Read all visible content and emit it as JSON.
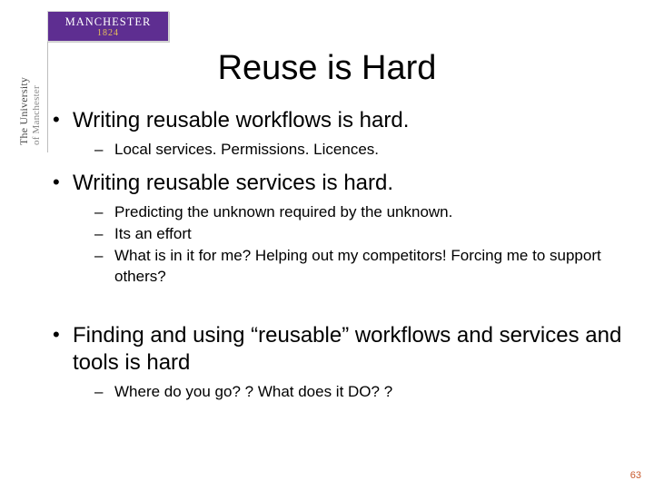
{
  "logo": {
    "line1": "MANCHESTER",
    "line2": "1824"
  },
  "sidebar": {
    "line1": "The University",
    "line2": "of Manchester"
  },
  "title": "Reuse is Hard",
  "bullets": [
    {
      "text": "Writing reusable workflows is hard.",
      "sub": [
        "Local services. Permissions. Licences."
      ]
    },
    {
      "text": "Writing reusable services is hard.",
      "sub": [
        "Predicting the unknown required by the unknown.",
        "Its an effort",
        "What is in it for me? Helping out my competitors! Forcing me to support others?"
      ]
    }
  ],
  "bullets2": [
    {
      "text": "Finding and using “reusable” workflows and services and tools is hard",
      "sub": [
        "Where do you go? ? What does it DO? ?"
      ]
    }
  ],
  "page_number": "63"
}
